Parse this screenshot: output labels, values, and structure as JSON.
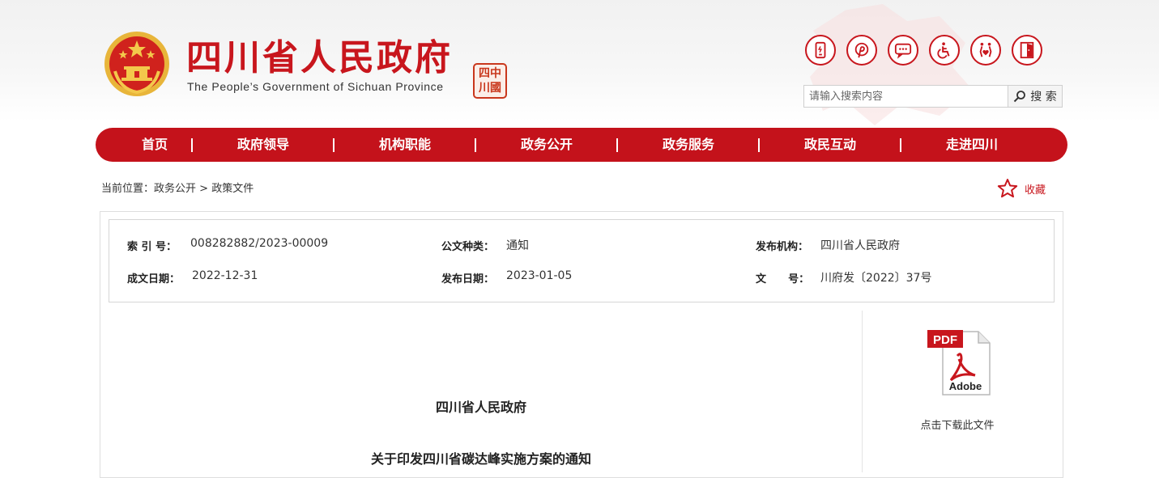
{
  "header": {
    "title": "四川省人民政府",
    "subtitle": "The People’s Government of Sichuan Province",
    "seal_text": [
      "中",
      "國",
      "四",
      "川"
    ]
  },
  "tools": [
    {
      "icon": "mobile-icon"
    },
    {
      "icon": "pinterest-icon"
    },
    {
      "icon": "message-icon"
    },
    {
      "icon": "accessibility-icon"
    },
    {
      "icon": "elderly-care-icon"
    },
    {
      "icon": "exit-door-icon"
    }
  ],
  "search": {
    "placeholder": "请输入搜索内容",
    "button_label": "搜 索"
  },
  "nav": {
    "items": [
      "首页",
      "政府领导",
      "机构职能",
      "政务公开",
      "政务服务",
      "政民互动",
      "走进四川"
    ],
    "separator": "|"
  },
  "breadcrumb": {
    "prefix": "当前位置：",
    "items": [
      "政务公开",
      "政策文件"
    ],
    "separator": ">"
  },
  "favorite": {
    "label": "收藏"
  },
  "meta": {
    "index_label": "索 引 号：",
    "index_value": "008282882/2023-00009",
    "type_label": "公文种类：",
    "type_value": "通知",
    "issuer_label": "发布机构：",
    "issuer_value": "四川省人民政府",
    "created_label": "成文日期：",
    "created_value": "2022-12-31",
    "published_label": "发布日期：",
    "published_value": "2023-01-05",
    "docno_label": "文      号：",
    "docno_value": "川府发〔2022〕37号"
  },
  "download": {
    "pdf_label": "PDF",
    "adobe_label": "Adobe",
    "caption": "点击下载此文件"
  },
  "document": {
    "org": "四川省人民政府",
    "title": "关于印发四川省碳达峰实施方案的通知"
  },
  "colors": {
    "brand_red": "#c8161d",
    "nav_red": "#c4121b"
  }
}
